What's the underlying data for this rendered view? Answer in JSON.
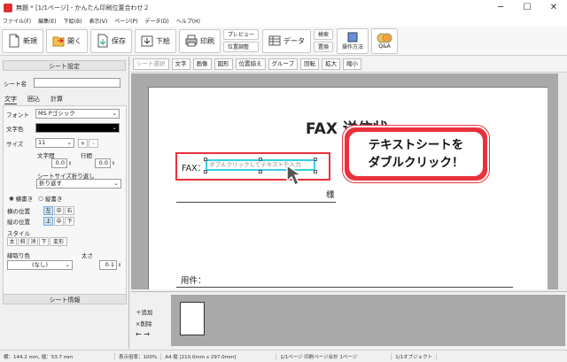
{
  "window": {
    "title": "無題 * [1/1ページ] - かんたん印刷位置合わせ２",
    "minimize": "─",
    "maximize": "☐",
    "close": "✕"
  },
  "menu": [
    "ファイル(F)",
    "編集(E)",
    "下絵(B)",
    "表示(V)",
    "ページ(P)",
    "データ(D)",
    "ヘルプ(H)"
  ],
  "toolbar": {
    "new": "新規",
    "open": "開く",
    "save": "保存",
    "import_bg": "下絵",
    "print": "印刷",
    "preview": "プレビュー",
    "position_adjust": "位置調整",
    "data": "データ",
    "search": "検索",
    "replace": "置換",
    "how_to": "操作方法",
    "qa": "Q&A"
  },
  "left_panel": {
    "header": "シート設定",
    "sheet_name_label": "シート名",
    "sheet_name_value": "",
    "tabs": [
      "文字",
      "囲込",
      "計算"
    ],
    "font_label": "フォント",
    "font_value": "MS Pゴシック",
    "color_label": "文字色",
    "size_label": "サイズ",
    "size_value": "11",
    "char_spacing_label": "文字間",
    "char_spacing_value": "0.0",
    "line_spacing_label": "行間",
    "line_spacing_value": "0.0",
    "wrap_label": "シートサイズ折り返し",
    "wrap_value": "折り返す",
    "horizontal": "横書き",
    "vertical": "縦書き",
    "h_pos_label": "横の位置",
    "h_pos": [
      "左",
      "中",
      "右"
    ],
    "v_pos_label": "縦の位置",
    "v_pos": [
      "上",
      "中",
      "下"
    ],
    "style_label": "スタイル",
    "styles": [
      "太",
      "斜",
      "消",
      "下",
      "変形"
    ],
    "border_color_label": "線取り色",
    "border_color_value": "(なし)",
    "thickness_label": "太さ",
    "thickness_value": "0.1",
    "footer": "シート情報"
  },
  "canvas_toolbar": [
    "シート選択",
    "文字",
    "画像",
    "図形",
    "位置揃え",
    "グループ",
    "回転",
    "拡大",
    "縮小"
  ],
  "document": {
    "heading": "FAX 送信状",
    "fax_label": "FAX：",
    "placeholder": "ダブルクリックしてテキストを入力",
    "sama": "様",
    "subject_label": "用件："
  },
  "page_controls": {
    "add": "追加",
    "delete": "削除"
  },
  "callout": {
    "line1": "テキストシートを",
    "line2": "ダブルクリック！"
  },
  "status": {
    "pos": "横：144.2 mm, 縦：53.7 mm",
    "zoom": "表示倍率：100%",
    "paper": "A4 縦 [210.0mm x 297.0mm]",
    "pages": "1/1ページ 印刷ページ合計 1ページ",
    "objects": "1/1オブジェクト"
  },
  "colors": {
    "accent": "#e9323c",
    "selection": "#35d0ea"
  }
}
